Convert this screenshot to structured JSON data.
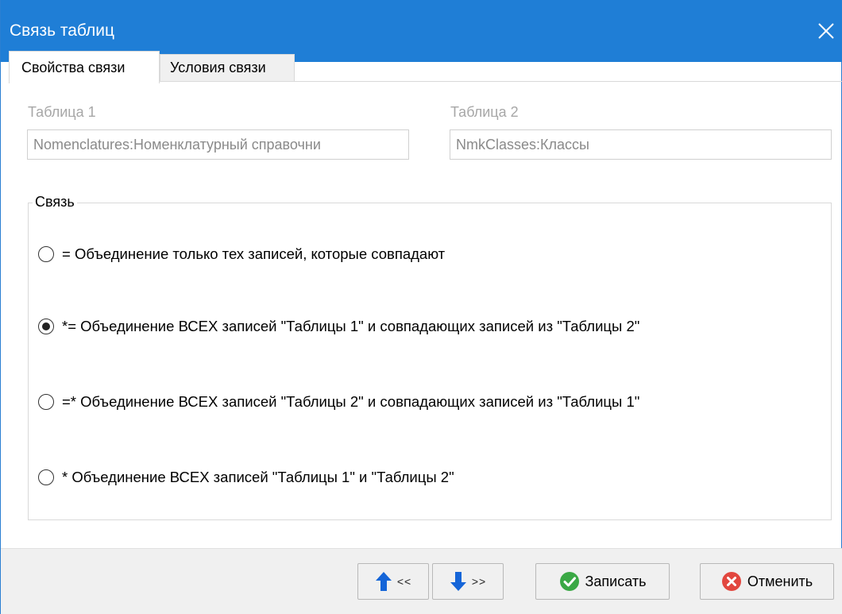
{
  "window": {
    "title": "Связь таблиц"
  },
  "tabs": [
    {
      "label": "Свойства связи",
      "active": true
    },
    {
      "label": "Условия связи",
      "active": false
    }
  ],
  "table1": {
    "label": "Таблица 1",
    "value": "Nomenclatures:Номенклатурный справочни"
  },
  "table2": {
    "label": "Таблица 2",
    "value": "NmkClasses:Классы"
  },
  "link_group": {
    "caption": "Связь",
    "options": [
      {
        "label": "=  Объединение только тех записей, которые совпадают",
        "checked": false
      },
      {
        "label": "*= Объединение ВСЕХ записей \"Таблицы 1\" и совпадающих записей из \"Таблицы 2\"",
        "checked": true
      },
      {
        "label": "=* Объединение ВСЕХ записей \"Таблицы 2\" и совпадающих записей из \"Таблицы 1\"",
        "checked": false
      },
      {
        "label": "*  Объединение ВСЕХ записей \"Таблицы 1\" и \"Таблицы 2\"",
        "checked": false
      }
    ]
  },
  "footer": {
    "prev_label": "<<",
    "next_label": ">>",
    "save_label": "Записать",
    "cancel_label": "Отменить"
  },
  "colors": {
    "titlebar": "#1f7ed6",
    "arrow_blue": "#1565d8",
    "save_green": "#3aa845",
    "cancel_red": "#e2473f"
  }
}
